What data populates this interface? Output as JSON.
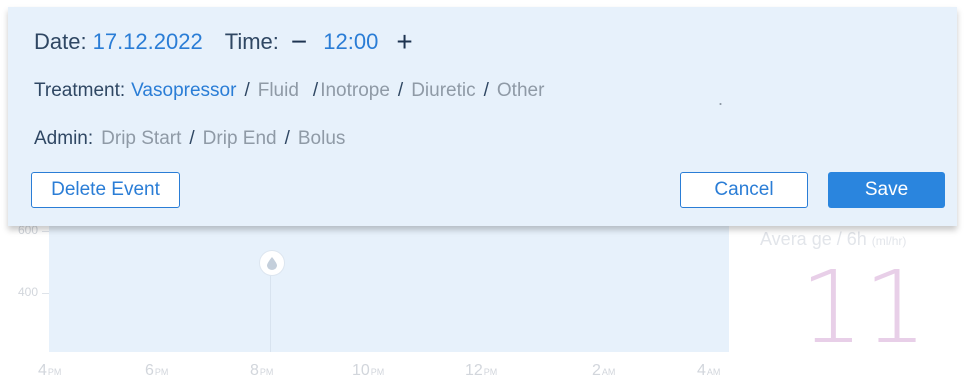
{
  "chart": {
    "y_ticks": [
      "600",
      "400"
    ],
    "x_ticks": [
      {
        "value": "4",
        "suffix": "PM"
      },
      {
        "value": "6",
        "suffix": "PM"
      },
      {
        "value": "8",
        "suffix": "PM"
      },
      {
        "value": "10",
        "suffix": "PM"
      },
      {
        "value": "12",
        "suffix": "PM"
      },
      {
        "value": "2",
        "suffix": "AM"
      },
      {
        "value": "4",
        "suffix": "AM"
      }
    ],
    "marker_icon": "drop-icon"
  },
  "average": {
    "label": "Avera ge / 6h",
    "unit": "(ml/hr)",
    "value": "11"
  },
  "dialog": {
    "date_label": "Date:",
    "date_value": "17.12.2022",
    "time_label": "Time:",
    "time_value": "12:00",
    "decrement_symbol": "−",
    "increment_symbol": "+",
    "treatment_label": "Treatment:",
    "treatment_selected": "Vasopressor",
    "treatment_options": [
      "Fluid",
      "Inotrope",
      "Diuretic",
      "Other"
    ],
    "admin_label": "Admin:",
    "admin_options": [
      "Drip Start",
      "Drip End",
      "Bolus"
    ],
    "delete_label": "Delete Event",
    "cancel_label": "Cancel",
    "save_label": "Save"
  },
  "colors": {
    "accent": "#2a7dd6",
    "dialog_bg": "#e7f1fb",
    "label": "#2f4763",
    "inactive": "#8f9aa6"
  }
}
